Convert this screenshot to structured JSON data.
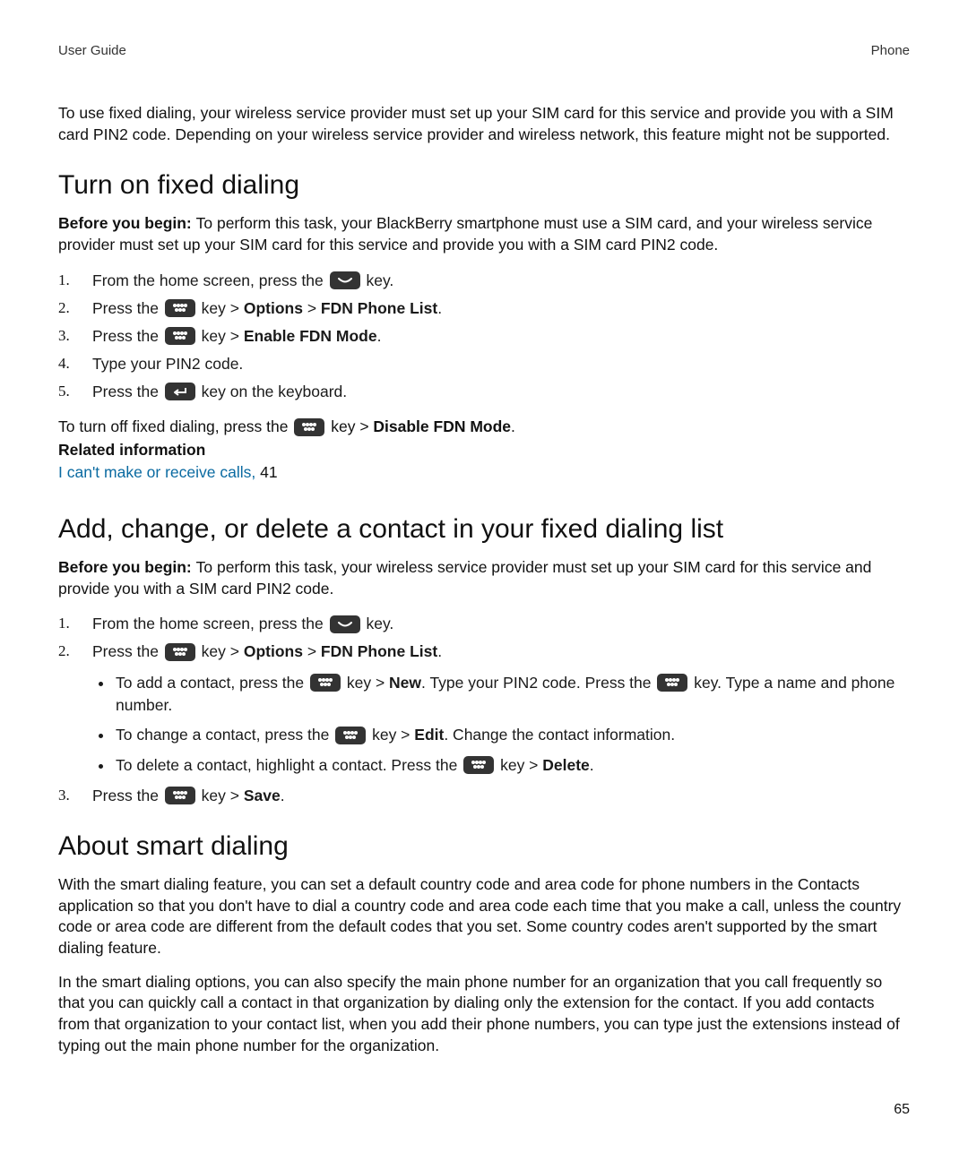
{
  "header": {
    "left": "User Guide",
    "right": "Phone"
  },
  "intro": "To use fixed dialing, your wireless service provider must set up your SIM card for this service and provide you with a SIM card PIN2 code. Depending on your wireless service provider and wireless network, this feature might not be supported.",
  "section1": {
    "title": "Turn on fixed dialing",
    "before_label": "Before you begin: ",
    "before_text": "To perform this task, your BlackBerry smartphone must use a SIM card, and your wireless service provider must set up your SIM card for this service and provide you with a SIM card PIN2 code.",
    "step1_a": "From the home screen, press the ",
    "step1_b": " key.",
    "step2_a": "Press the ",
    "step2_b": " key > ",
    "step2_opt": "Options",
    "step2_c": " > ",
    "step2_fdn": "FDN Phone List",
    "step2_d": ".",
    "step3_a": "Press the ",
    "step3_b": " key > ",
    "step3_bold": "Enable FDN Mode",
    "step3_c": ".",
    "step4": "Type your PIN2 code.",
    "step5_a": "Press the ",
    "step5_b": " key on the keyboard.",
    "off_a": "To turn off fixed dialing, press the ",
    "off_b": " key > ",
    "off_bold": "Disable FDN Mode",
    "off_c": ".",
    "related_label": "Related information",
    "related_link": "I can't make or receive calls, ",
    "related_page": "41"
  },
  "section2": {
    "title": "Add, change, or delete a contact in your fixed dialing list",
    "before_label": "Before you begin: ",
    "before_text": "To perform this task, your wireless service provider must set up your SIM card for this service and provide you with a SIM card PIN2 code.",
    "step1_a": "From the home screen, press the ",
    "step1_b": " key.",
    "step2_a": "Press the ",
    "step2_b": " key > ",
    "step2_opt": "Options",
    "step2_c": " > ",
    "step2_fdn": "FDN Phone List",
    "step2_d": ".",
    "bullet1_a": "To add a contact, press the ",
    "bullet1_b": " key > ",
    "bullet1_bold": "New",
    "bullet1_c": ". Type your PIN2 code. Press the ",
    "bullet1_d": " key. Type a name and phone number.",
    "bullet2_a": "To change a contact, press the ",
    "bullet2_b": " key > ",
    "bullet2_bold": "Edit",
    "bullet2_c": ". Change the contact information.",
    "bullet3_a": "To delete a contact, highlight a contact. Press the ",
    "bullet3_b": " key > ",
    "bullet3_bold": "Delete",
    "bullet3_c": ".",
    "step3_a": "Press the ",
    "step3_b": " key > ",
    "step3_bold": "Save",
    "step3_c": "."
  },
  "section3": {
    "title": "About smart dialing",
    "p1": "With the smart dialing feature, you can set a default country code and area code for phone numbers in the Contacts application so that you don't have to dial a country code and area code each time that you make a call, unless the country code or area code are different from the default codes that you set. Some country codes aren't supported by the smart dialing feature.",
    "p2": "In the smart dialing options, you can also specify the main phone number for an organization that you call frequently so that you can quickly call a contact in that organization by dialing only the extension for the contact. If you add contacts from that organization to your contact list, when you add their phone numbers, you can type just the extensions instead of typing out the main phone number for the organization."
  },
  "page_number": "65"
}
